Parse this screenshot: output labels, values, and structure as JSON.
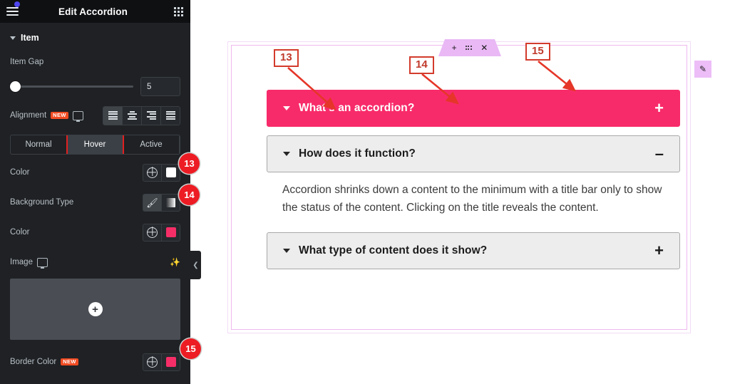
{
  "panel": {
    "title": "Edit Accordion",
    "menu_icon": "hamburger-icon",
    "grid_icon": "grid-apps-icon",
    "section": {
      "label": "Item",
      "caret": "caret-down-icon"
    },
    "item_gap": {
      "label": "Item Gap",
      "value": "5"
    },
    "alignment": {
      "label": "Alignment",
      "new_badge": "NEW",
      "device_icon": "monitor-icon",
      "options": [
        "align-left",
        "align-center",
        "align-right",
        "align-justify"
      ],
      "selected": "align-left"
    },
    "state_tabs": {
      "items": [
        "Normal",
        "Hover",
        "Active"
      ],
      "selected": "Hover"
    },
    "color_row": {
      "label": "Color",
      "swatch": "#ffffff",
      "globe_icon": "globe-icon"
    },
    "background_type": {
      "label": "Background Type",
      "options": [
        "classic-brush",
        "gradient"
      ],
      "selected": "classic-brush"
    },
    "background_color": {
      "label": "Color",
      "swatch": "#f62e67",
      "globe_icon": "globe-icon"
    },
    "image": {
      "label": "Image",
      "device_icon": "monitor-icon",
      "ai_icon": "sparkle-ai-icon",
      "add_icon": "plus-icon"
    },
    "border_color": {
      "label": "Border Color",
      "new_badge": "NEW",
      "swatch": "#f62e67",
      "globe_icon": "globe-icon"
    },
    "collapse_icon": "chevron-left-icon"
  },
  "canvas": {
    "widget_toolbar": {
      "add_icon": "plus-icon",
      "drag_icon": "drag-handle-icon",
      "close_icon": "close-icon"
    },
    "edit_pencil": {
      "icon": "pencil-edit-icon"
    },
    "accordion": {
      "items": [
        {
          "title": "What's an accordion?",
          "sign": "+",
          "state": "active",
          "body": ""
        },
        {
          "title": "How does it function?",
          "sign": "–",
          "state": "open",
          "body": "Accordion shrinks down a content to the minimum with a title bar only to show the status of the content. Clicking on the title reveals the content."
        },
        {
          "title": "What type of content does it show?",
          "sign": "+",
          "state": "normal",
          "body": ""
        }
      ]
    }
  },
  "annotations": {
    "callouts": [
      {
        "label": "13"
      },
      {
        "label": "14"
      },
      {
        "label": "15"
      }
    ],
    "badges": [
      {
        "label": "13"
      },
      {
        "label": "14"
      },
      {
        "label": "15"
      }
    ]
  },
  "colors": {
    "accent_pink": "#f82b6a",
    "annotation_red": "#ed1c24",
    "toolbar_purple": "#e9b8f5",
    "panel_bg": "#1f2124"
  }
}
